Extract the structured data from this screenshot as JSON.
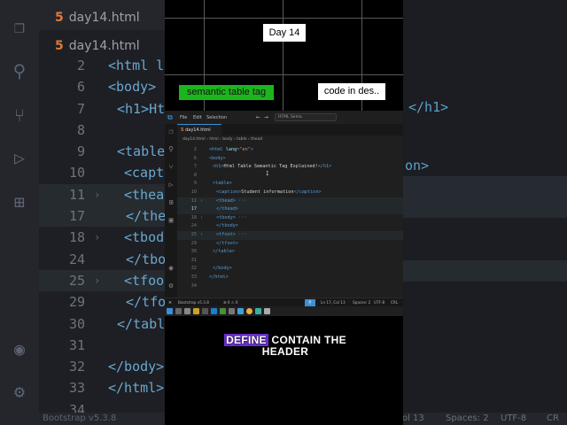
{
  "background": {
    "tab_main": "day14.html",
    "tab_secondary": "day14.html",
    "lines": [
      {
        "num": "2",
        "code": "<html la",
        "tag": true
      },
      {
        "num": "6",
        "code": "<body>",
        "tag": true
      },
      {
        "num": "7",
        "code": "<h1>Ht",
        "tag": true
      },
      {
        "num": "8",
        "code": "",
        "tag": false
      },
      {
        "num": "9",
        "code": "<table",
        "tag": true
      },
      {
        "num": "10",
        "code": "<capt",
        "tag": true
      },
      {
        "num": "11",
        "code": "<thea",
        "tag": true
      },
      {
        "num": "17",
        "code": "</the",
        "tag": true
      },
      {
        "num": "18",
        "code": "<tbod",
        "tag": true
      },
      {
        "num": "24",
        "code": "</tbo",
        "tag": true
      },
      {
        "num": "25",
        "code": "<tfoo",
        "tag": true
      },
      {
        "num": "29",
        "code": "</tfo",
        "tag": true
      },
      {
        "num": "30",
        "code": "</tabl",
        "tag": true
      },
      {
        "num": "31",
        "code": "",
        "tag": false
      },
      {
        "num": "32",
        "code": "</body>",
        "tag": true
      },
      {
        "num": "33",
        "code": "</html>",
        "tag": true
      },
      {
        "num": "34",
        "code": "",
        "tag": false
      }
    ],
    "right_fragments": [
      "</h1>",
      "on>",
      "Col 13",
      "Spaces: 2",
      "UTF-8",
      "CR"
    ],
    "status_left": "Bootstrap v5.3.8"
  },
  "overlay": {
    "day_label": "Day 14",
    "green_label": "semantic table tag",
    "white_label": "code in des.."
  },
  "vscode": {
    "menu": [
      "File",
      "Edit",
      "Selection"
    ],
    "search_placeholder": "HTML Sema",
    "tab": "day14.html",
    "breadcrumb": [
      "day14.html",
      "html",
      "body",
      "table",
      "thead"
    ],
    "lines": [
      {
        "num": "2",
        "parts": [
          [
            "tag",
            "<html "
          ],
          [
            "attr",
            "lang"
          ],
          [
            "pun",
            "="
          ],
          [
            "str",
            "\"en\""
          ],
          [
            "tag",
            ">"
          ]
        ]
      },
      {
        "num": "6",
        "parts": [
          [
            "tag",
            "<body>"
          ]
        ]
      },
      {
        "num": "7",
        "parts": [
          [
            "tag",
            "<h1>"
          ],
          [
            "txt",
            "Html Table Semantic Tag Explained!"
          ],
          [
            "tag",
            "</h1>"
          ]
        ]
      },
      {
        "num": "8",
        "parts": []
      },
      {
        "num": "9",
        "parts": [
          [
            "tag",
            "<table>"
          ]
        ]
      },
      {
        "num": "10",
        "parts": [
          [
            "tag",
            "<caption>"
          ],
          [
            "txt",
            "Student information"
          ],
          [
            "tag",
            "</caption>"
          ]
        ]
      },
      {
        "num": "11",
        "parts": [
          [
            "tag",
            "<thead>"
          ],
          [
            "dots",
            " ···"
          ]
        ],
        "fold": "›",
        "hl": true
      },
      {
        "num": "17",
        "parts": [
          [
            "tag",
            "</thead>"
          ]
        ],
        "hl": true,
        "current": true
      },
      {
        "num": "18",
        "parts": [
          [
            "tag",
            "<tbody>"
          ],
          [
            "dots",
            " ···"
          ]
        ],
        "fold": "›"
      },
      {
        "num": "24",
        "parts": [
          [
            "tag",
            "</tbody>"
          ]
        ]
      },
      {
        "num": "25",
        "parts": [
          [
            "tag",
            "<tfoot>"
          ],
          [
            "dots",
            " ···"
          ]
        ],
        "fold": "›",
        "hl": true
      },
      {
        "num": "29",
        "parts": [
          [
            "tag",
            "</tfoot>"
          ]
        ]
      },
      {
        "num": "30",
        "parts": [
          [
            "tag",
            "</table>"
          ]
        ]
      },
      {
        "num": "31",
        "parts": []
      },
      {
        "num": "32",
        "parts": [
          [
            "tag",
            "</body>"
          ]
        ]
      },
      {
        "num": "33",
        "parts": [
          [
            "tag",
            "</html>"
          ]
        ]
      },
      {
        "num": "34",
        "parts": []
      }
    ],
    "status": {
      "bootstrap": "Bootstrap v5.3.8",
      "problems": "⊗ 0 ⚠ 0",
      "position": "Ln 17, Col 13",
      "spaces": "Spaces: 2",
      "encoding": "UTF-8",
      "eol": "CRL"
    }
  },
  "caption": {
    "highlight": "DEFINE",
    "rest_line1": "CONTAIN THE",
    "line2": "HEADER",
    "highlight_color": "#6a2fd1"
  }
}
